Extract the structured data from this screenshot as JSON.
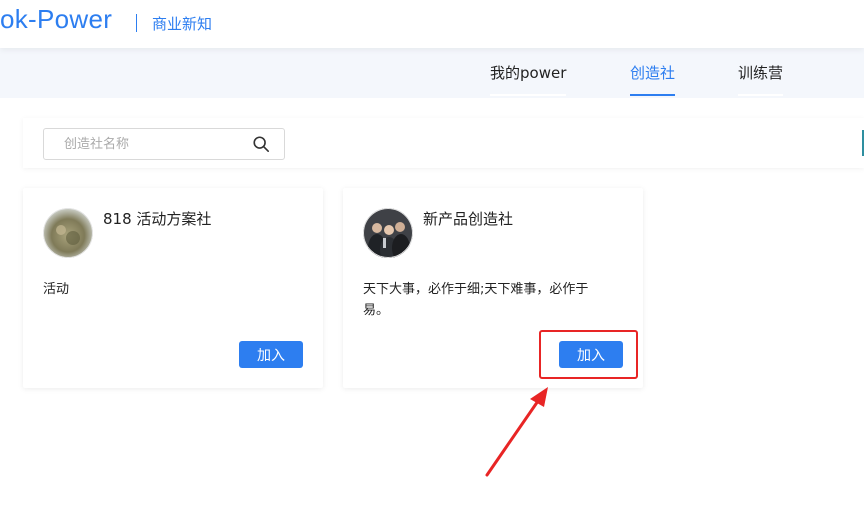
{
  "header": {
    "logo_text": "ok-Power",
    "tagline": "商业新知"
  },
  "nav": {
    "items": [
      {
        "label": "我的power",
        "active": false
      },
      {
        "label": "创造社",
        "active": true
      },
      {
        "label": "训练营",
        "active": false
      }
    ]
  },
  "search": {
    "placeholder": "创造社名称",
    "value": "",
    "icon": "search-icon"
  },
  "cards": [
    {
      "name": "818 活动方案社",
      "description": "活动",
      "join_label": "加入",
      "avatar_icon": "group-photo"
    },
    {
      "name": "新产品创造社",
      "description": "天下大事，必作于细;天下难事，必作于易。",
      "join_label": "加入",
      "avatar_icon": "group-photo"
    }
  ],
  "colors": {
    "accent": "#2d7ef0",
    "annotation": "#e82525",
    "nav_background": "#f4f7fc"
  }
}
